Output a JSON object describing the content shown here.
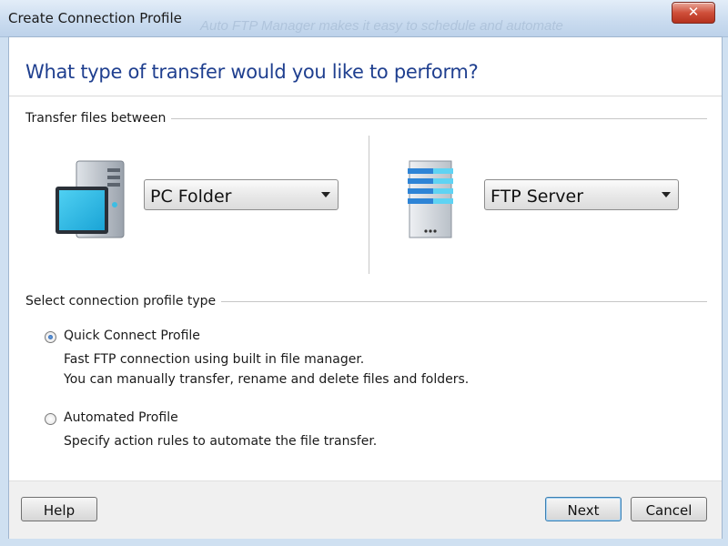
{
  "window": {
    "title": "Create Connection Profile",
    "background_ghost_text": "Auto FTP Manager makes it easy to schedule and automate",
    "close_glyph": "✕"
  },
  "heading": "What type of transfer would you like to perform?",
  "transfer": {
    "group_label": "Transfer files between",
    "source": {
      "icon": "computer-icon",
      "selected": "PC Folder"
    },
    "destination": {
      "icon": "ftp-server-icon",
      "selected": "FTP Server"
    }
  },
  "profile_type": {
    "group_label": "Select connection profile type",
    "options": [
      {
        "label": "Quick Connect Profile",
        "checked": true,
        "description": [
          "Fast FTP connection using built in file manager.",
          "You can manually transfer, rename and delete files and folders."
        ]
      },
      {
        "label": "Automated Profile",
        "checked": false,
        "description": [
          "Specify action rules to automate the file transfer."
        ]
      }
    ]
  },
  "buttons": {
    "help": "Help",
    "next": "Next",
    "cancel": "Cancel"
  },
  "colors": {
    "heading": "#1f3f8f",
    "close": "#cf4f3a",
    "accent": "#3dbde3"
  }
}
